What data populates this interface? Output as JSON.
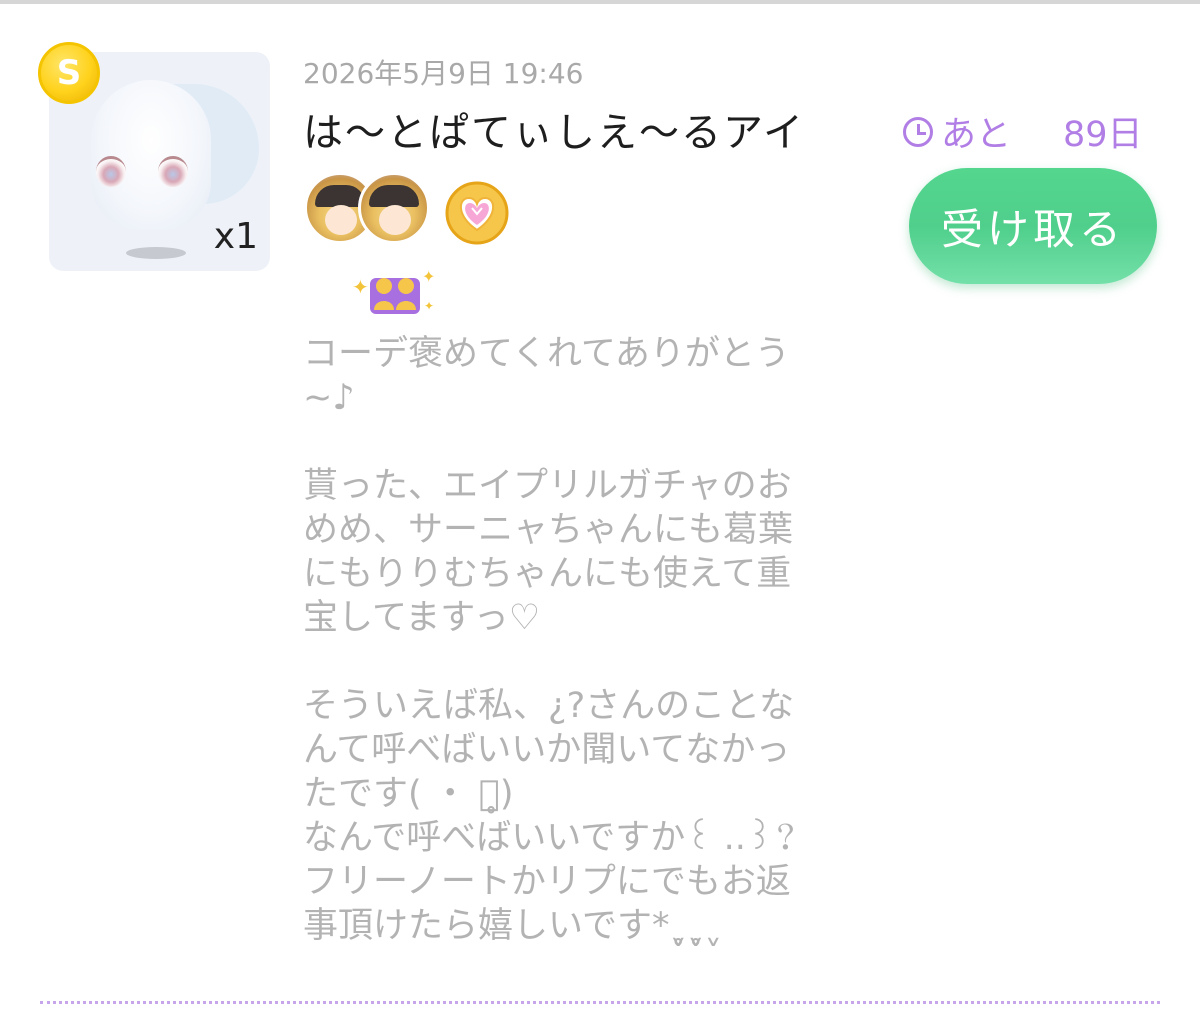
{
  "item": {
    "quantity": "x1",
    "coin_letter": "S"
  },
  "header": {
    "date": "2026年5月9日 19:46",
    "sender": "は〜とぱてぃしえ〜るアイ"
  },
  "deadline": {
    "prefix": "あと",
    "days": "89日",
    "icon": "clock-icon",
    "color": "#b17ee6"
  },
  "actions": {
    "receive_label": "受け取る",
    "receive_color": "#4fcf8b"
  },
  "badges": {
    "avatar_1": "character-avatar",
    "avatar_2": "character-avatar",
    "heart_icon": "heart-jewel-icon",
    "friend_icon": "friends-icon"
  },
  "message": {
    "text": "コーデ褒めてくれてありがとう\n~♪\n\n貰った、エイプリルガチャのお\nめめ、サーニャちゃんにも葛葉\nにもりりむちゃんにも使えて重\n宝してますっ♡\n\nそういえば私、¿?さんのことな\nんて呼べばいいか聞いてなかっ\nたです( ・ ・̥)\nなんで呼べばいいですか꒰ ..꒱？\nフリーノートかリプにでもお返\n事頂けたら嬉しいです*ˬ̥ˬ̥ˬ"
  }
}
